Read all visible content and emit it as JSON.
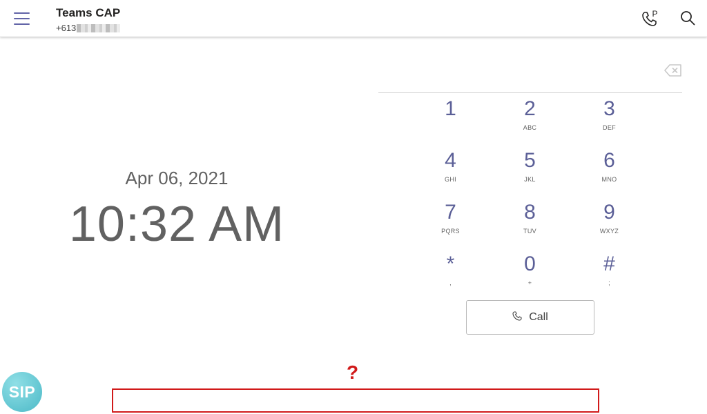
{
  "header": {
    "title": "Teams CAP",
    "number_prefix": "+613",
    "icons": {
      "menu": "hamburger-menu-icon",
      "park": "call-park-icon",
      "search": "search-icon"
    }
  },
  "clock": {
    "date": "Apr 06, 2021",
    "time": "10:32 AM"
  },
  "dialer": {
    "input_value": "",
    "keys": [
      {
        "digit": "1",
        "letters": ""
      },
      {
        "digit": "2",
        "letters": "ABC"
      },
      {
        "digit": "3",
        "letters": "DEF"
      },
      {
        "digit": "4",
        "letters": "GHI"
      },
      {
        "digit": "5",
        "letters": "JKL"
      },
      {
        "digit": "6",
        "letters": "MNO"
      },
      {
        "digit": "7",
        "letters": "PQRS"
      },
      {
        "digit": "8",
        "letters": "TUV"
      },
      {
        "digit": "9",
        "letters": "WXYZ"
      },
      {
        "digit": "*",
        "letters": ","
      },
      {
        "digit": "0",
        "letters": "+"
      },
      {
        "digit": "#",
        "letters": ";"
      }
    ],
    "call_label": "Call"
  },
  "overlay": {
    "question_mark": "?",
    "sip_badge": "SIP"
  },
  "colors": {
    "accent": "#6264a7",
    "digit": "#5b5f97",
    "text_gray": "#616161",
    "annotation_red": "#d11a1a",
    "sip_teal": "#4cb9c7"
  }
}
